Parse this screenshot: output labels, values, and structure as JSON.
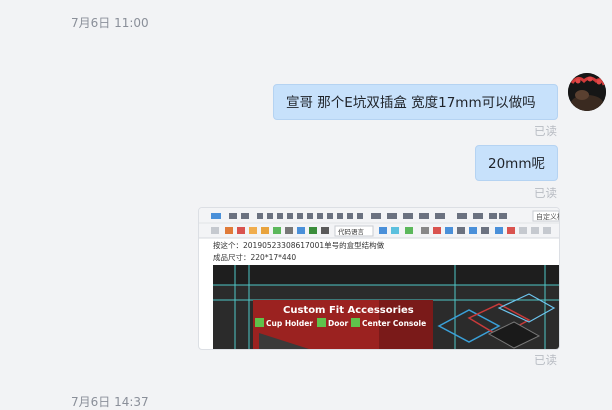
{
  "timestamps": [
    "7月6日 11:00",
    "7月6日 14:37"
  ],
  "messages": [
    {
      "text": "宣哥 那个E坑双插盒 宽度17mm可以做吗",
      "status": "已读"
    },
    {
      "text": "20mm呢",
      "status": "已读"
    },
    {
      "type": "image",
      "status": "已读"
    }
  ],
  "image_content": {
    "toolbar_right_text": "自定义标",
    "code_select": "代码语言",
    "line1": "按这个：20190523308617001单号的盒型结构做",
    "line2": "成品尺寸：220*17*440",
    "banner_title": "Custom Fit Accessories",
    "features": [
      "Cup Holder",
      "Door",
      "Center Console"
    ]
  }
}
